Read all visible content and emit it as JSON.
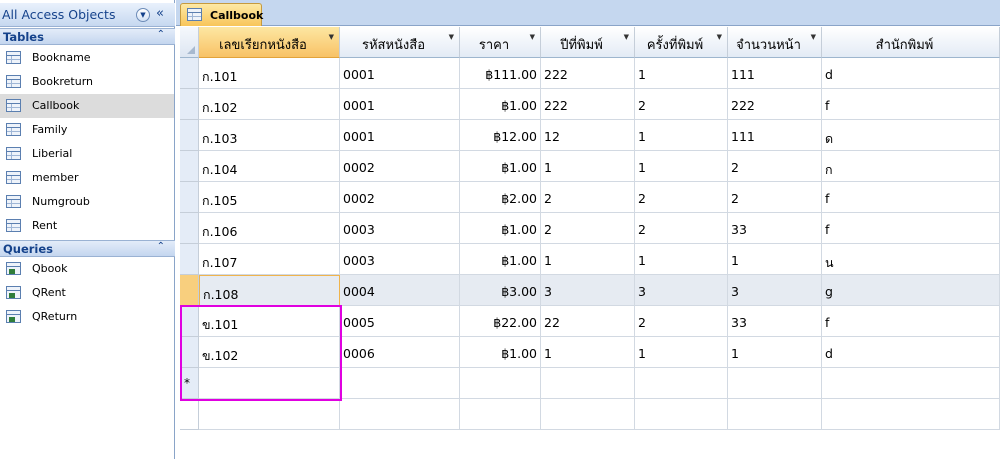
{
  "nav": {
    "title": "All Access Objects",
    "groups": [
      {
        "label": "Tables",
        "items": [
          {
            "label": "Bookname",
            "icon": "table-icon"
          },
          {
            "label": "Bookreturn",
            "icon": "table-icon"
          },
          {
            "label": "Callbook",
            "icon": "table-icon",
            "selected": true
          },
          {
            "label": "Family",
            "icon": "table-icon"
          },
          {
            "label": "Liberial",
            "icon": "table-icon"
          },
          {
            "label": "member",
            "icon": "table-icon"
          },
          {
            "label": "Numgroub",
            "icon": "table-icon"
          },
          {
            "label": "Rent",
            "icon": "table-icon"
          }
        ]
      },
      {
        "label": "Queries",
        "items": [
          {
            "label": "Qbook",
            "icon": "query-icon"
          },
          {
            "label": "QRent",
            "icon": "query-icon"
          },
          {
            "label": "QReturn",
            "icon": "query-icon"
          }
        ]
      }
    ]
  },
  "tab": {
    "label": "Callbook"
  },
  "table": {
    "columns": [
      "เลขเรียกหนังสือ",
      "รหัสหนังสือ",
      "ราคา",
      "ปีที่พิมพ์",
      "ครั้งที่พิมพ์",
      "จำนวนหน้า",
      "สำนักพิมพ์"
    ],
    "rows": [
      [
        "ก.101",
        "0001",
        "฿111.00",
        "222",
        "1",
        "111",
        "d"
      ],
      [
        "ก.102",
        "0001",
        "฿1.00",
        "222",
        "2",
        "222",
        "f"
      ],
      [
        "ก.103",
        "0001",
        "฿12.00",
        "12",
        "1",
        "111",
        "ด"
      ],
      [
        "ก.104",
        "0002",
        "฿1.00",
        "1",
        "1",
        "2",
        "ก"
      ],
      [
        "ก.105",
        "0002",
        "฿2.00",
        "2",
        "2",
        "2",
        "f"
      ],
      [
        "ก.106",
        "0003",
        "฿1.00",
        "2",
        "2",
        "33",
        "f"
      ],
      [
        "ก.107",
        "0003",
        "฿1.00",
        "1",
        "1",
        "1",
        "น"
      ],
      [
        "ก.108",
        "0004",
        "฿3.00",
        "3",
        "3",
        "3",
        "g"
      ],
      [
        "ข.101",
        "0005",
        "฿22.00",
        "22",
        "2",
        "33",
        "f"
      ],
      [
        "ข.102",
        "0006",
        "฿1.00",
        "1",
        "1",
        "1",
        "d"
      ]
    ],
    "current_row": 7,
    "new_record_marker": "*"
  },
  "colors": {
    "highlight": "#e000e0",
    "active_header": "#f8c266"
  }
}
